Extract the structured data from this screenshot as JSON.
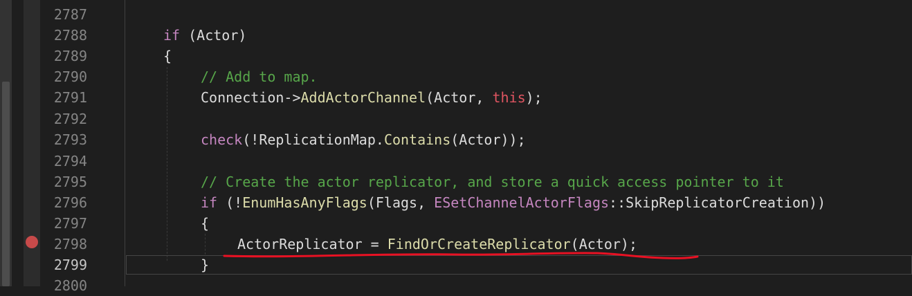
{
  "colors": {
    "background": "#1e1e1e",
    "line_number": "#858585",
    "keyword": "#c586c0",
    "comment": "#57a64a",
    "function": "#dcdcaa",
    "this_keyword": "#e05561",
    "annotation_underline": "#e81123",
    "breakpoint": "#c74a4a"
  },
  "editor": {
    "line_numbers": [
      "2787",
      "2788",
      "2789",
      "2790",
      "2791",
      "2792",
      "2793",
      "2794",
      "2795",
      "2796",
      "2797",
      "2798",
      "2799",
      "2800"
    ],
    "current_line": "2799",
    "breakpoint_line": "2798",
    "code": {
      "l2788": {
        "if": "if",
        "rest": " (Actor)"
      },
      "l2789": {
        "brace": "{"
      },
      "l2790": {
        "comment": "// Add to map."
      },
      "l2791": {
        "obj": "Connection",
        "arrow": "->",
        "fn": "AddActorChannel",
        "args": "(Actor, ",
        "this": "this",
        "end": ");"
      },
      "l2793": {
        "check": "check",
        "a": "(!",
        "obj": "ReplicationMap",
        "dot": ".",
        "fn": "Contains",
        "end": "(Actor));"
      },
      "l2795": {
        "comment": "// Create the actor replicator, and store a quick access pointer to it"
      },
      "l2796": {
        "if": "if",
        "a": " (!",
        "fn": "EnumHasAnyFlags",
        "b": "(Flags, ",
        "type": "ESetChannelActorFlags",
        "sep": "::",
        "member": "SkipReplicatorCreation",
        "end": "))"
      },
      "l2797": {
        "brace": "{"
      },
      "l2798": {
        "var": "ActorReplicator",
        "eq": " = ",
        "fn": "FindOrCreateReplicator",
        "end": "(Actor);"
      },
      "l2799": {
        "brace": "}"
      }
    }
  }
}
